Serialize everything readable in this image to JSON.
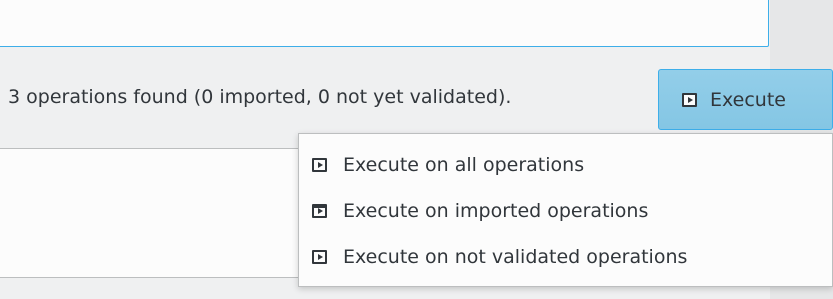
{
  "status": {
    "text": "3 operations found (0 imported, 0 not yet validated)."
  },
  "execute_button": {
    "label": "Execute",
    "icon": "play-icon"
  },
  "execute_menu": {
    "items": [
      {
        "label": "Execute on all operations",
        "icon": "play-icon"
      },
      {
        "label": "Execute on imported operations",
        "icon": "play-icon"
      },
      {
        "label": "Execute on not validated operations",
        "icon": "play-icon"
      }
    ]
  },
  "colors": {
    "accent": "#3daee9",
    "button_bg": "#93cee9",
    "text": "#31363b",
    "background": "#eff0f1"
  }
}
